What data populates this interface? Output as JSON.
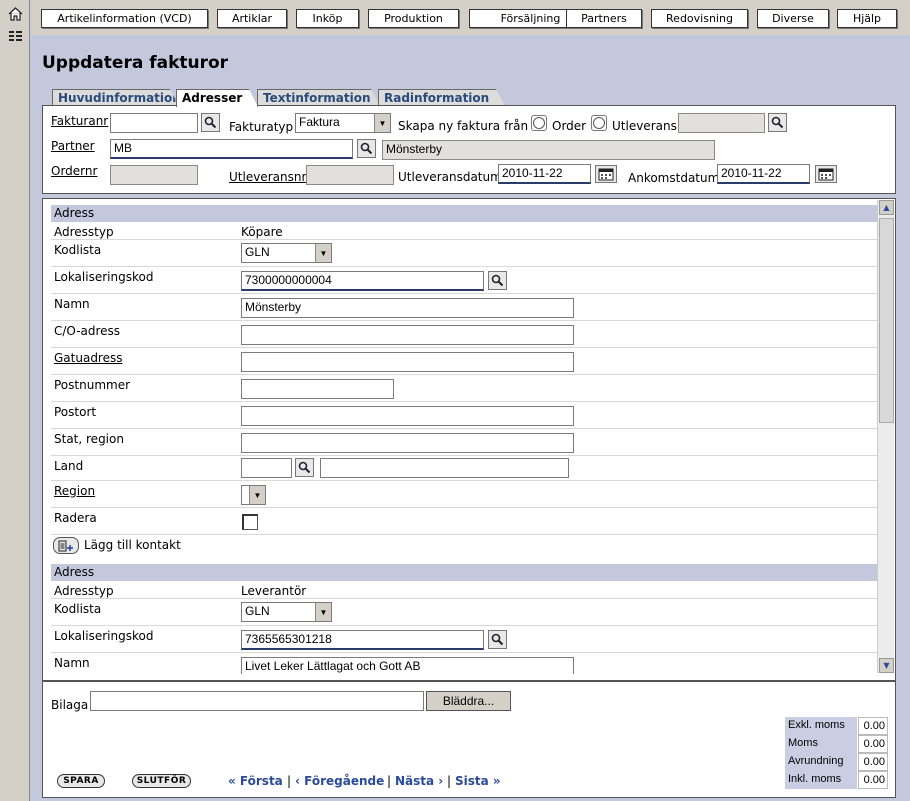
{
  "menu": [
    "Artikelinformation (VCD)",
    "Artiklar",
    "Inköp",
    "Produktion",
    "Försäljning",
    "Partners",
    "Redovisning",
    "Diverse",
    "Hjälp"
  ],
  "page_title": "Uppdatera fakturor",
  "tabs": [
    "Huvudinformation",
    "Adresser",
    "Textinformation",
    "Radinformation"
  ],
  "active_tab": "Adresser",
  "header_form": {
    "fakturanr_label": "Fakturanr",
    "fakturanr_value": "",
    "fakturatyp_label": "Fakturatyp",
    "fakturatyp_value": "Faktura",
    "skapa_label": "Skapa ny faktura från",
    "order_label": "Order",
    "utleverans_label": "Utleverans",
    "utleverans_value": "",
    "partner_label": "Partner",
    "partner_value": "MB",
    "partner_name": "Mönsterby",
    "ordernr_label": "Ordernr",
    "ordernr_value": "",
    "utleveransnr_label": "Utleveransnr",
    "utleveransnr_value": "",
    "utleveransdatum_label": "Utleveransdatum",
    "utleveransdatum_value": "2010-11-22",
    "ankomstdatum_label": "Ankomstdatum",
    "ankomstdatum_value": "2010-11-22"
  },
  "address1": {
    "section_title": "Adress",
    "adresstyp_label": "Adresstyp",
    "adresstyp_value": "Köpare",
    "kodlista_label": "Kodlista",
    "kodlista_value": "GLN",
    "lokaliseringskod_label": "Lokaliseringskod",
    "lokaliseringskod_value": "7300000000004",
    "namn_label": "Namn",
    "namn_value": "Mönsterby",
    "co_label": "C/O-adress",
    "co_value": "",
    "gatuadress_label": "Gatuadress",
    "gatuadress_value": "",
    "postnummer_label": "Postnummer",
    "postnummer_value": "",
    "postort_label": "Postort",
    "postort_value": "",
    "stat_label": "Stat, region",
    "stat_value": "",
    "land_label": "Land",
    "land_code": "",
    "land_name": "",
    "region_label": "Region",
    "radera_label": "Radera",
    "add_contact_label": "Lägg till kontakt"
  },
  "address2": {
    "section_title": "Adress",
    "adresstyp_label": "Adresstyp",
    "adresstyp_value": "Leverantör",
    "kodlista_label": "Kodlista",
    "kodlista_value": "GLN",
    "lokaliseringskod_label": "Lokaliseringskod",
    "lokaliseringskod_value": "7365565301218",
    "namn_label": "Namn",
    "namn_value": "Livet Leker Lättlagat och Gott AB"
  },
  "footer": {
    "bilaga_label": "Bilaga",
    "bilaga_value": "",
    "browse_label": "Bläddra...",
    "spara_label": "SPARA",
    "slutfor_label": "SLUTFÖR",
    "nav_first": "« Första",
    "nav_prev": "‹ Föregående",
    "nav_next": "Nästa ›",
    "nav_last": "Sista »",
    "sep": "|"
  },
  "totals": [
    {
      "label": "Exkl. moms",
      "value": "0.00"
    },
    {
      "label": "Moms",
      "value": "0.00"
    },
    {
      "label": "Avrundning",
      "value": "0.00"
    },
    {
      "label": "Inkl. moms",
      "value": "0.00"
    }
  ],
  "colors": {
    "accent": "#2a4a9a",
    "header_bg": "#c3c8dc",
    "menu_bg": "#d4d0c8"
  },
  "icons": {
    "home": "home-icon",
    "list": "list-icon",
    "search": "search-icon",
    "calendar": "calendar-icon"
  }
}
